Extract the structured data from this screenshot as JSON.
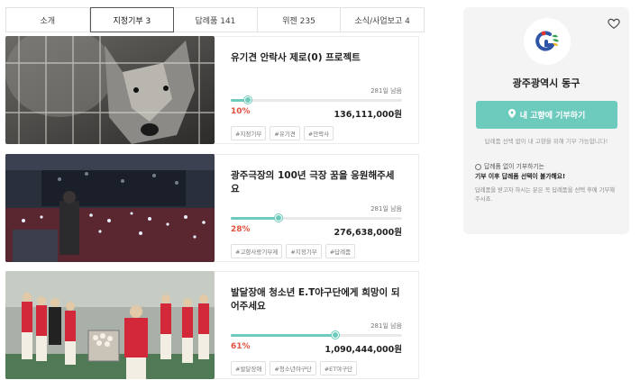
{
  "tabs": [
    {
      "label": "소개",
      "active": false
    },
    {
      "label": "지정기부 3",
      "active": true
    },
    {
      "label": "답례품 141",
      "active": false
    },
    {
      "label": "위젠 235",
      "active": false
    },
    {
      "label": "소식/사업보고 4",
      "active": false
    }
  ],
  "projects": [
    {
      "title": "유기견 안락사 제로(0) 프로젝트",
      "remaining": "281일 남음",
      "progress_pct": 10,
      "progress_label": "10%",
      "amount": "136,111,000원",
      "tags": [
        "#지정기부",
        "#유기견",
        "#안락사"
      ]
    },
    {
      "title": "광주극장의 100년 극장 꿈을 응원해주세요",
      "remaining": "281일 남음",
      "progress_pct": 28,
      "progress_label": "28%",
      "amount": "276,638,000원",
      "tags": [
        "#고향사랑기부제",
        "#지정기부",
        "#답례품"
      ]
    },
    {
      "title": "발달장애 청소년 E.T야구단에게 희망이 되어주세요",
      "remaining": "281일 남음",
      "progress_pct": 61,
      "progress_label": "61%",
      "amount": "1,090,444,000원",
      "tags": [
        "#발달장애",
        "#청소년야구단",
        "#ET야구단"
      ]
    }
  ],
  "sidebar": {
    "org_name": "광주광역시 동구",
    "donate_button": "내 고향에 기부하기",
    "note": "답례품 선택 없이 내 고향을 위해 기부 가능합니다!",
    "notice_title": "답례품 없이 기부하기는",
    "notice_bold": "기부 이후 답례품 선택이 불가해요!",
    "notice_desc": "답례품을 받고자 하시는 분은 꼭 답례품을 선택 후에 기부해주시죠."
  },
  "colors": {
    "accent": "#6dcbbd",
    "percent": "#e0523e"
  }
}
